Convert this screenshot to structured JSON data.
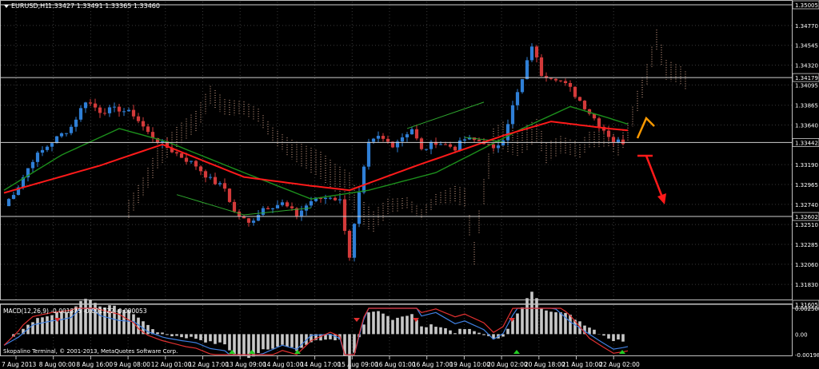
{
  "header": {
    "symbol_label": "EURUSD,H1",
    "ohlc": "1.33427 1.33491 1.33365 1.33460"
  },
  "macd_header": "MACD(12,26,9) -0.001375 -0.001322 -0.000053",
  "copyright": "Skopalino Terminal, © 2001-2013, MetaQuotes Software Corp.",
  "colors": {
    "background": "#000000",
    "grid": "#3a3a3a",
    "bull": "#2f7fd6",
    "bear": "#d33a3a",
    "ma_red": "#ff1a1a",
    "ma_green": "#1c8f1c",
    "cloud": "#d9a890",
    "arrow_orange": "#ff9900",
    "arrow_red": "#ff1a1a",
    "macd_blue": "#3f7fe0",
    "macd_red": "#e03030",
    "hist": "#c8c8c8"
  },
  "chart_data": [
    {
      "type": "candlestick",
      "symbol": "EURUSD",
      "timeframe": "H1",
      "price_levels": [
        {
          "value": "1.35005",
          "line": true
        },
        {
          "value": "1.34770",
          "line": false
        },
        {
          "value": "1.34545",
          "line": false
        },
        {
          "value": "1.34320",
          "line": false
        },
        {
          "value": "1.34179",
          "line": true
        },
        {
          "value": "1.34095",
          "line": false
        },
        {
          "value": "1.33865",
          "line": false
        },
        {
          "value": "1.33640",
          "line": false
        },
        {
          "value": "1.33442",
          "line": true
        },
        {
          "value": "1.33190",
          "line": false
        },
        {
          "value": "1.32965",
          "line": false
        },
        {
          "value": "1.32740",
          "line": false
        },
        {
          "value": "1.32602",
          "line": true
        },
        {
          "value": "1.32510",
          "line": false
        },
        {
          "value": "1.32285",
          "line": false
        },
        {
          "value": "1.32060",
          "line": false
        },
        {
          "value": "1.31830",
          "line": false
        },
        {
          "value": "1.31605",
          "line": true
        }
      ],
      "ylim": [
        1.31605,
        1.35005
      ],
      "x_labels": [
        "7 Aug 2013",
        "8 Aug 00:00",
        "8 Aug 16:00",
        "9 Aug 08:00",
        "12 Aug 01:00",
        "12 Aug 17:00",
        "13 Aug 09:00",
        "14 Aug 01:00",
        "14 Aug 17:00",
        "15 Aug 09:00",
        "16 Aug 01:00",
        "16 Aug 17:00",
        "19 Aug 10:00",
        "20 Aug 02:00",
        "20 Aug 18:00",
        "21 Aug 10:00",
        "22 Aug 02:00"
      ],
      "price_path": [
        [
          0,
          1.3272
        ],
        [
          3,
          1.3295
        ],
        [
          6,
          1.3325
        ],
        [
          10,
          1.3345
        ],
        [
          14,
          1.3362
        ],
        [
          17,
          1.3392
        ],
        [
          20,
          1.338
        ],
        [
          24,
          1.3382
        ],
        [
          27,
          1.3376
        ],
        [
          30,
          1.3355
        ],
        [
          33,
          1.3342
        ],
        [
          37,
          1.3328
        ],
        [
          40,
          1.3318
        ],
        [
          43,
          1.3302
        ],
        [
          46,
          1.3292
        ],
        [
          48,
          1.3265
        ],
        [
          51,
          1.3252
        ],
        [
          54,
          1.327
        ],
        [
          58,
          1.3275
        ],
        [
          61,
          1.3262
        ],
        [
          64,
          1.3278
        ],
        [
          68,
          1.3283
        ],
        [
          70,
          1.3278
        ],
        [
          72,
          1.3215
        ],
        [
          74,
          1.3285
        ],
        [
          76,
          1.3342
        ],
        [
          78,
          1.335
        ],
        [
          81,
          1.3342
        ],
        [
          85,
          1.336
        ],
        [
          87,
          1.3335
        ],
        [
          90,
          1.3345
        ],
        [
          94,
          1.3338
        ],
        [
          96,
          1.3348
        ],
        [
          100,
          1.3345
        ],
        [
          102,
          1.3335
        ],
        [
          104,
          1.335
        ],
        [
          106,
          1.3385
        ],
        [
          108,
          1.3415
        ],
        [
          110,
          1.3455
        ],
        [
          112,
          1.3422
        ],
        [
          115,
          1.3418
        ],
        [
          118,
          1.3405
        ],
        [
          121,
          1.3385
        ],
        [
          124,
          1.3365
        ],
        [
          127,
          1.3346
        ],
        [
          129,
          1.3345
        ]
      ],
      "ma_red": [
        [
          0,
          1.3287
        ],
        [
          20,
          1.3318
        ],
        [
          33,
          1.3342
        ],
        [
          50,
          1.3305
        ],
        [
          64,
          1.3295
        ],
        [
          72,
          1.329
        ],
        [
          86,
          1.3318
        ],
        [
          104,
          1.3352
        ],
        [
          114,
          1.3368
        ],
        [
          126,
          1.336
        ],
        [
          130,
          1.3358
        ]
      ],
      "ma_green": [
        [
          0,
          1.329
        ],
        [
          12,
          1.333
        ],
        [
          24,
          1.336
        ],
        [
          34,
          1.3345
        ],
        [
          50,
          1.331
        ],
        [
          64,
          1.328
        ],
        [
          76,
          1.329
        ],
        [
          90,
          1.331
        ],
        [
          108,
          1.336
        ],
        [
          118,
          1.3385
        ],
        [
          126,
          1.3372
        ],
        [
          130,
          1.3365
        ]
      ]
    },
    {
      "type": "macd",
      "name": "MACD(12,26,9)",
      "values": [
        -0.001375,
        -0.001322,
        -5.3e-05
      ],
      "y_labels": [
        "0.002508",
        "0.00",
        "-0.001986"
      ],
      "ylim": [
        -0.001986,
        0.002508
      ]
    }
  ]
}
